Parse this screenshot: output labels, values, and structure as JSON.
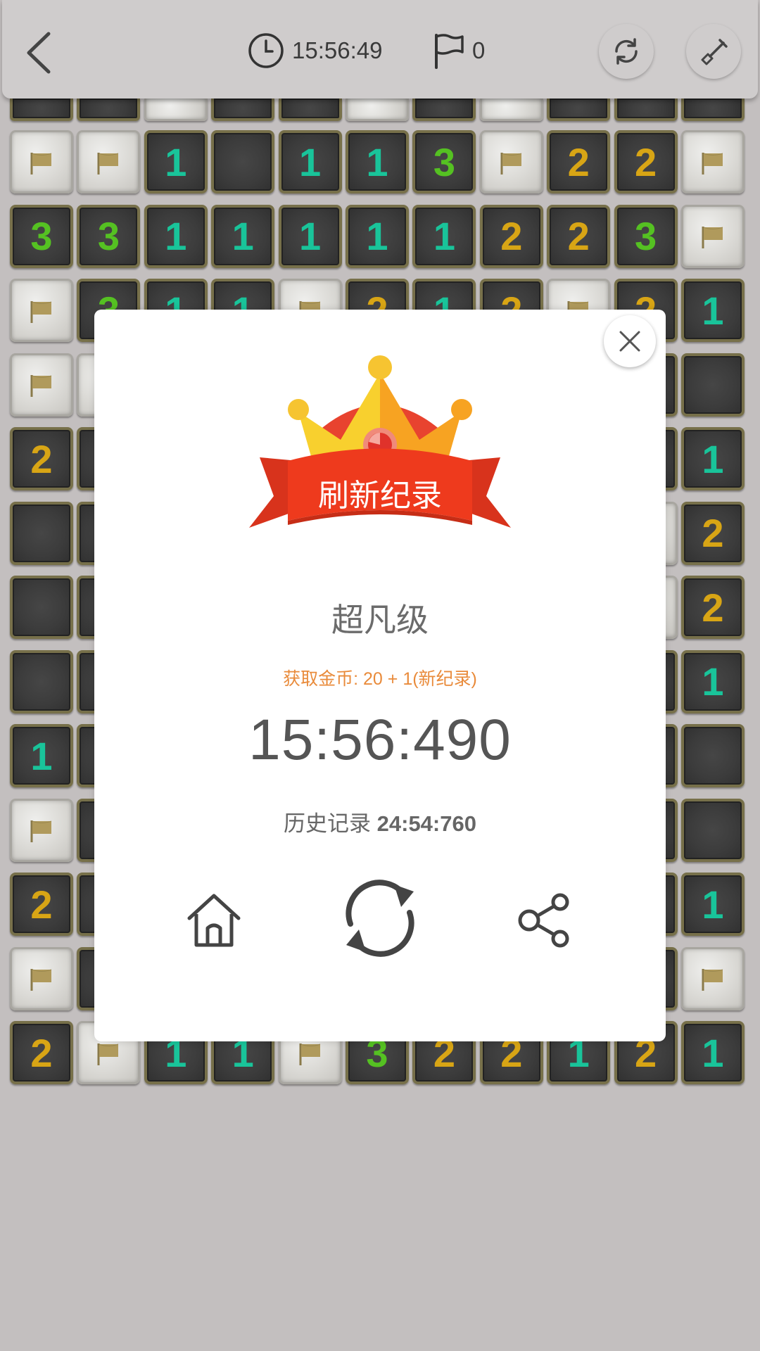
{
  "header": {
    "timer": "15:56:49",
    "flag_count": "0"
  },
  "board": {
    "top_partial_row": [
      "o",
      "o",
      "f",
      "o",
      "o",
      "f",
      "o",
      "f",
      "o",
      "o",
      "o"
    ],
    "rows": [
      [
        [
          "f",
          ""
        ],
        [
          "f",
          ""
        ],
        [
          "o",
          "1"
        ],
        [
          "o",
          ""
        ],
        [
          "o",
          "1"
        ],
        [
          "o",
          "1"
        ],
        [
          "o",
          "3"
        ],
        [
          "f",
          ""
        ],
        [
          "o",
          "2"
        ],
        [
          "o",
          "2"
        ],
        [
          "f",
          ""
        ]
      ],
      [
        [
          "o",
          "3"
        ],
        [
          "o",
          "3"
        ],
        [
          "o",
          "1"
        ],
        [
          "o",
          "1"
        ],
        [
          "o",
          "1"
        ],
        [
          "o",
          "1"
        ],
        [
          "o",
          "1"
        ],
        [
          "o",
          "2"
        ],
        [
          "o",
          "2"
        ],
        [
          "o",
          "3"
        ],
        [
          "f",
          ""
        ]
      ],
      [
        [
          "f",
          ""
        ],
        [
          "o",
          "3"
        ],
        [
          "o",
          "1"
        ],
        [
          "o",
          "1"
        ],
        [
          "f",
          ""
        ],
        [
          "o",
          "2"
        ],
        [
          "o",
          "1"
        ],
        [
          "o",
          "2"
        ],
        [
          "f",
          ""
        ],
        [
          "o",
          "2"
        ],
        [
          "o",
          "1"
        ]
      ],
      [
        [
          "f",
          ""
        ],
        [
          "f",
          ""
        ],
        [
          "o",
          ""
        ],
        [
          "o",
          ""
        ],
        [
          "o",
          ""
        ],
        [
          "o",
          ""
        ],
        [
          "o",
          ""
        ],
        [
          "o",
          ""
        ],
        [
          "o",
          ""
        ],
        [
          "o",
          ""
        ],
        [
          "o",
          ""
        ]
      ],
      [
        [
          "o",
          "2"
        ],
        [
          "o",
          ""
        ],
        [
          "o",
          ""
        ],
        [
          "o",
          ""
        ],
        [
          "o",
          ""
        ],
        [
          "o",
          ""
        ],
        [
          "o",
          ""
        ],
        [
          "o",
          ""
        ],
        [
          "o",
          ""
        ],
        [
          "o",
          ""
        ],
        [
          "o",
          "1"
        ]
      ],
      [
        [
          "o",
          ""
        ],
        [
          "o",
          ""
        ],
        [
          "o",
          ""
        ],
        [
          "o",
          ""
        ],
        [
          "o",
          ""
        ],
        [
          "o",
          ""
        ],
        [
          "o",
          ""
        ],
        [
          "o",
          ""
        ],
        [
          "o",
          ""
        ],
        [
          "f",
          ""
        ],
        [
          "o",
          "2"
        ]
      ],
      [
        [
          "o",
          ""
        ],
        [
          "o",
          ""
        ],
        [
          "o",
          ""
        ],
        [
          "o",
          ""
        ],
        [
          "o",
          ""
        ],
        [
          "o",
          ""
        ],
        [
          "o",
          ""
        ],
        [
          "o",
          ""
        ],
        [
          "o",
          ""
        ],
        [
          "f",
          ""
        ],
        [
          "o",
          "2"
        ]
      ],
      [
        [
          "o",
          ""
        ],
        [
          "o",
          ""
        ],
        [
          "o",
          ""
        ],
        [
          "o",
          ""
        ],
        [
          "o",
          ""
        ],
        [
          "o",
          ""
        ],
        [
          "o",
          ""
        ],
        [
          "o",
          ""
        ],
        [
          "o",
          ""
        ],
        [
          "o",
          ""
        ],
        [
          "o",
          "1"
        ]
      ],
      [
        [
          "o",
          "1"
        ],
        [
          "o",
          ""
        ],
        [
          "o",
          ""
        ],
        [
          "o",
          ""
        ],
        [
          "o",
          ""
        ],
        [
          "o",
          ""
        ],
        [
          "o",
          ""
        ],
        [
          "o",
          ""
        ],
        [
          "o",
          ""
        ],
        [
          "o",
          ""
        ],
        [
          "o",
          ""
        ]
      ],
      [
        [
          "f",
          ""
        ],
        [
          "o",
          ""
        ],
        [
          "o",
          ""
        ],
        [
          "o",
          ""
        ],
        [
          "o",
          ""
        ],
        [
          "o",
          ""
        ],
        [
          "o",
          ""
        ],
        [
          "o",
          ""
        ],
        [
          "o",
          ""
        ],
        [
          "o",
          ""
        ],
        [
          "o",
          ""
        ]
      ],
      [
        [
          "o",
          "2"
        ],
        [
          "o",
          ""
        ],
        [
          "o",
          ""
        ],
        [
          "o",
          ""
        ],
        [
          "o",
          ""
        ],
        [
          "o",
          ""
        ],
        [
          "o",
          ""
        ],
        [
          "o",
          ""
        ],
        [
          "o",
          ""
        ],
        [
          "o",
          ""
        ],
        [
          "o",
          "1"
        ]
      ],
      [
        [
          "f",
          ""
        ],
        [
          "o",
          ""
        ],
        [
          "o",
          ""
        ],
        [
          "o",
          ""
        ],
        [
          "o",
          ""
        ],
        [
          "o",
          ""
        ],
        [
          "o",
          ""
        ],
        [
          "o",
          ""
        ],
        [
          "o",
          ""
        ],
        [
          "o",
          ""
        ],
        [
          "f",
          ""
        ]
      ],
      [
        [
          "o",
          "2"
        ],
        [
          "f",
          ""
        ],
        [
          "o",
          "1"
        ],
        [
          "o",
          "1"
        ],
        [
          "f",
          ""
        ],
        [
          "o",
          "3"
        ],
        [
          "o",
          "2"
        ],
        [
          "o",
          "2"
        ],
        [
          "o",
          "1"
        ],
        [
          "o",
          "2"
        ],
        [
          "o",
          "1"
        ]
      ]
    ]
  },
  "dialog": {
    "banner_text": "刷新纪录",
    "level": "超凡级",
    "coins": "获取金币: 20 + 1(新纪录)",
    "time": "15:56:490",
    "history_label": "历史记录",
    "history_value": "24:54:760"
  }
}
